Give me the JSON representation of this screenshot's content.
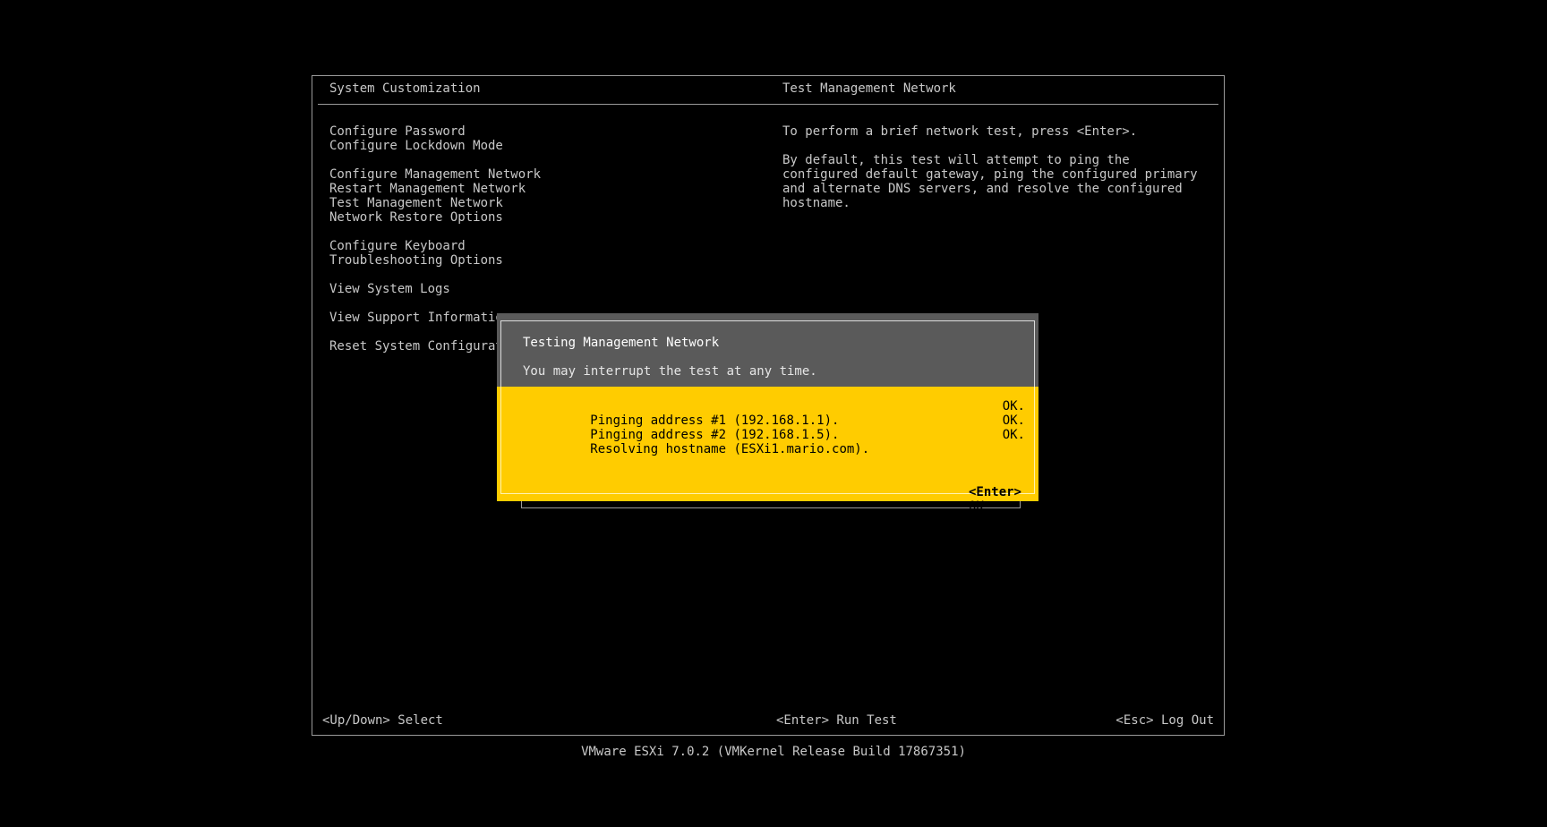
{
  "header": {
    "left_title": "System Customization",
    "right_title": "Test Management Network"
  },
  "menu": {
    "items": [
      {
        "label": "Configure Password"
      },
      {
        "label": "Configure Lockdown Mode"
      },
      {
        "label": "Configure Management Network"
      },
      {
        "label": "Restart Management Network"
      },
      {
        "label": "Test Management Network"
      },
      {
        "label": "Network Restore Options"
      },
      {
        "label": "Configure Keyboard"
      },
      {
        "label": "Troubleshooting Options"
      },
      {
        "label": "View System Logs"
      },
      {
        "label": "View Support Informatio"
      },
      {
        "label": "Reset System Configurat"
      }
    ]
  },
  "help": {
    "line1": "To perform a brief network test, press <Enter>.",
    "line2": "By default, this test will attempt to ping the configured default gateway, ping the configured primary and alternate DNS servers, and resolve the configured hostname."
  },
  "footer": {
    "left_hint": "<Up/Down> Select",
    "center_hint": "<Enter> Run Test",
    "right_hint": "<Esc> Log Out"
  },
  "build_info": "VMware ESXi 7.0.2 (VMKernel Release Build 17867351)",
  "dialog": {
    "title": "Testing Management Network",
    "subtitle": "You may interrupt the test at any time.",
    "results": [
      {
        "text": "Pinging address #1 (192.168.1.1).",
        "status": "OK."
      },
      {
        "text": "Pinging address #2 (192.168.1.5).",
        "status": "OK."
      },
      {
        "text": "Resolving hostname (ESXi1.mario.com).",
        "status": "OK."
      }
    ],
    "ok_key": "<Enter>",
    "ok_label": "OK"
  },
  "colors": {
    "background": "#000000",
    "text": "#c8c8c8",
    "dialog_header": "#5a5a5a",
    "dialog_body": "#ffcc00"
  }
}
